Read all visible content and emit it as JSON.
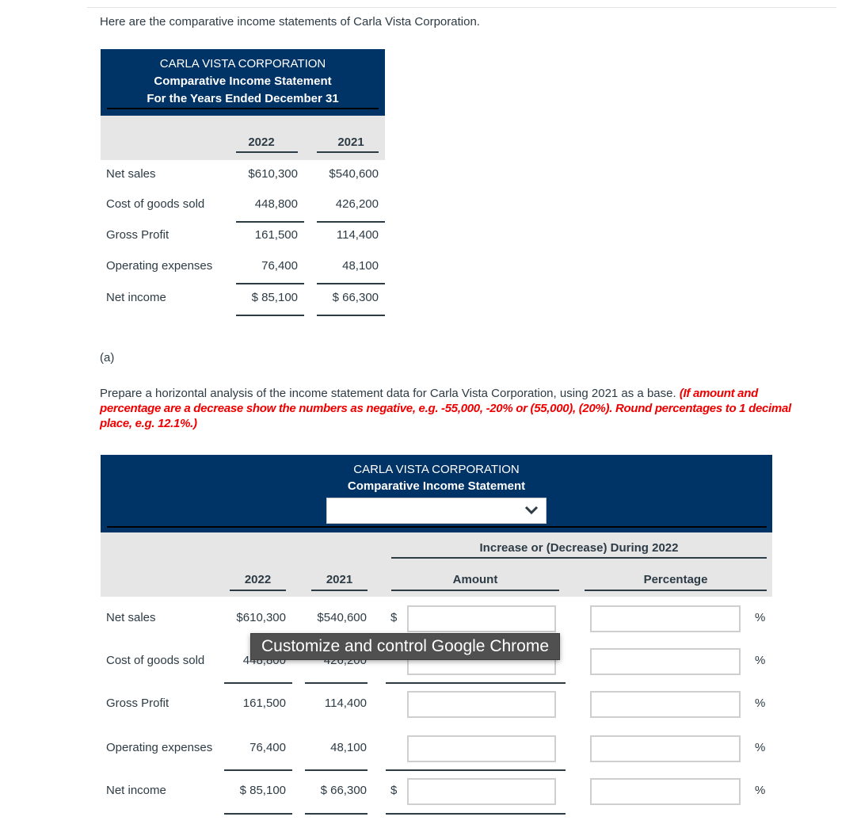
{
  "intro": "Here are the comparative income statements of Carla Vista Corporation.",
  "statement": {
    "company": "CARLA VISTA CORPORATION",
    "title": "Comparative Income Statement",
    "period": "For the Years Ended December 31",
    "col_2022": "2022",
    "col_2021": "2021",
    "rows": [
      {
        "label": "Net sales",
        "v2022": "$610,300",
        "v2021": "$540,600"
      },
      {
        "label": "Cost of goods sold",
        "v2022": "448,800",
        "v2021": "426,200"
      },
      {
        "label": "Gross Profit",
        "v2022": "161,500",
        "v2021": "114,400"
      },
      {
        "label": "Operating expenses",
        "v2022": "76,400",
        "v2021": "48,100"
      },
      {
        "label": "Net income",
        "v2022": "$ 85,100",
        "v2021": "$ 66,300"
      }
    ]
  },
  "part": "(a)",
  "instruction": "Prepare a horizontal analysis of the income statement data for Carla Vista Corporation, using 2021 as a base.",
  "instruction_note": "(If amount and percentage are a decrease show the numbers as negative, e.g. -55,000, -20% or (55,000), (20%). Round percentages to 1 decimal place, e.g. 12.1%.)",
  "analysis": {
    "company": "CARLA VISTA CORPORATION",
    "title": "Comparative Income Statement",
    "period_select": "",
    "group_header": "Increase or (Decrease) During 2022",
    "col_2022": "2022",
    "col_2021": "2021",
    "col_amount": "Amount",
    "col_pct": "Percentage",
    "currency": "$",
    "pct_sign": "%",
    "rows": [
      {
        "label": "Net sales",
        "v2022": "$610,300",
        "v2021": "$540,600",
        "amount": "",
        "pct": ""
      },
      {
        "label": "Cost of goods sold",
        "v2022": "448,800",
        "v2021": "426,200",
        "amount": "",
        "pct": ""
      },
      {
        "label": "Gross Profit",
        "v2022": "161,500",
        "v2021": "114,400",
        "amount": "",
        "pct": ""
      },
      {
        "label": "Operating expenses",
        "v2022": "76,400",
        "v2021": "48,100",
        "amount": "",
        "pct": ""
      },
      {
        "label": "Net income",
        "v2022": "$ 85,100",
        "v2021": "$ 66,300",
        "amount": "",
        "pct": ""
      }
    ]
  },
  "tooltip": "Customize and control Google Chrome",
  "colors": {
    "header": "#003366",
    "note": "#ee0000",
    "subheader": "#e6e6e6"
  }
}
